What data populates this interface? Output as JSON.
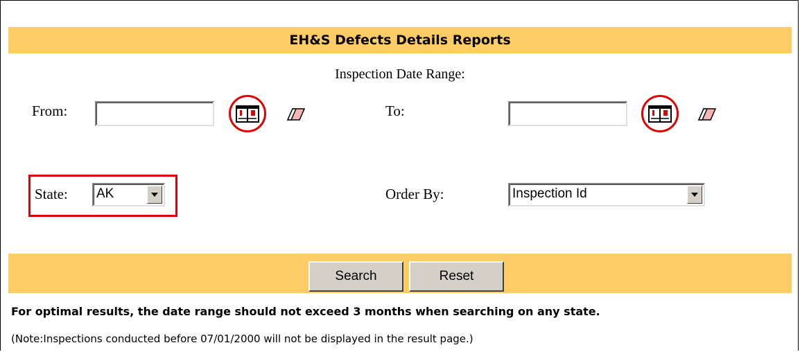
{
  "header": {
    "title": "EH&S Defects Details Reports"
  },
  "form": {
    "date_range_label": "Inspection Date Range:",
    "from_label": "From:",
    "to_label": "To:",
    "from_value": "",
    "to_value": "",
    "state_label": "State:",
    "state_value": "AK",
    "order_by_label": "Order By:",
    "order_by_value": "Inspection Id"
  },
  "buttons": {
    "search": "Search",
    "reset": "Reset"
  },
  "notes": {
    "optimal": "For optimal results, the date range should not exceed 3 months when searching on any state.",
    "note": "(Note:Inspections conducted before 07/01/2000 will not be displayed in the result page.)"
  },
  "icons": {
    "calendar": "calendar-icon",
    "eraser": "eraser-icon",
    "dropdown": "chevron-down-icon"
  },
  "colors": {
    "bar": "#ffcc66",
    "highlight": "#e00000"
  }
}
